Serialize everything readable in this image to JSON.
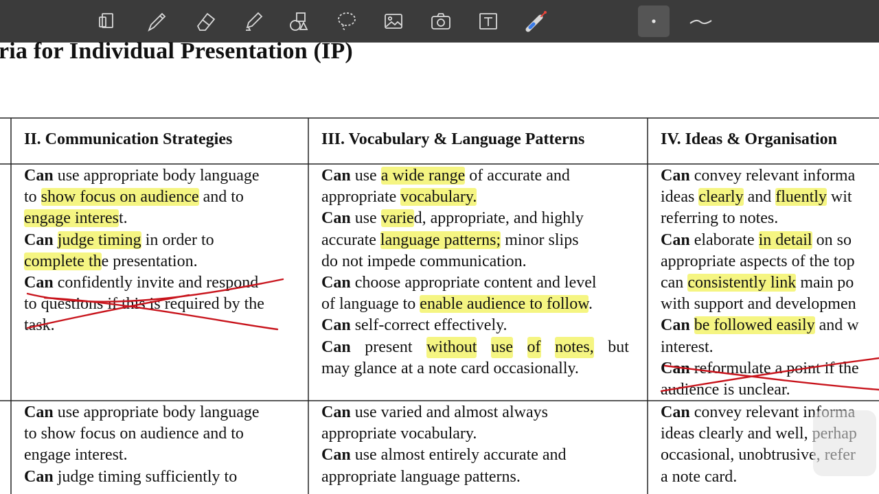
{
  "toolbar": {
    "tools": [
      {
        "name": "page-tool-icon"
      },
      {
        "name": "pen-tool-icon"
      },
      {
        "name": "eraser-tool-icon"
      },
      {
        "name": "highlighter-tool-icon"
      },
      {
        "name": "shapes-tool-icon"
      },
      {
        "name": "lasso-tool-icon"
      },
      {
        "name": "image-tool-icon"
      },
      {
        "name": "camera-tool-icon"
      },
      {
        "name": "text-tool-icon"
      },
      {
        "name": "laser-pointer-icon"
      },
      {
        "name": "stroke-dot-icon"
      },
      {
        "name": "stroke-curve-icon"
      }
    ],
    "colors": {
      "bar": "#3b3b3b",
      "icon": "#d9d9d9",
      "active_bg": "#555555",
      "laser_red": "#e8443a",
      "laser_blue": "#3a7be8"
    }
  },
  "document": {
    "title": "ria for Individual Presentation (IP)",
    "headers": {
      "col2": "II. Communication Strategies",
      "col3": "III. Vocabulary & Language Patterns",
      "col4": "IV. Ideas & Organisation"
    },
    "highlight_color": "#f5f582",
    "annotation_color": "#c8141c",
    "row1": {
      "col2": {
        "l1": [
          [
            "Can",
            "b"
          ],
          " use appropriate body language"
        ],
        "l2": [
          "to ",
          [
            "show focus on audience",
            "hl"
          ],
          " and to"
        ],
        "l3": [
          [
            "engage interes",
            "hl"
          ],
          "t."
        ],
        "l4": [
          [
            "Can",
            "b"
          ],
          " ",
          [
            "judge timing",
            "hl"
          ],
          " in order to"
        ],
        "l5": [
          [
            "complete th",
            "hl"
          ],
          "e presentation."
        ],
        "l6": [
          [
            "Can",
            "b"
          ],
          " confidently invite and respond"
        ],
        "l7": [
          "to questions if this is required by the"
        ],
        "l8": [
          "task."
        ]
      },
      "col3": {
        "l1": [
          [
            "Can",
            "b"
          ],
          " use ",
          [
            "a wide range",
            "hl"
          ],
          " of accurate and"
        ],
        "l2": [
          " appropriate ",
          [
            "vocabulary.",
            "hl"
          ]
        ],
        "l3": [
          [
            "Can",
            "b"
          ],
          " use ",
          [
            "varie",
            "hl"
          ],
          "d, appropriate, and highly"
        ],
        "l4": [
          "accurate ",
          [
            "language patterns;",
            "hl"
          ],
          " minor slips"
        ],
        "l5": [
          "do not impede communication."
        ],
        "l6": [
          [
            "Can",
            "b"
          ],
          " choose appropriate content and level"
        ],
        "l7": [
          "of language to ",
          [
            "enable audience to follow",
            "hl"
          ],
          "."
        ],
        "l8": [
          [
            "Can",
            "b"
          ],
          " self-correct effectively."
        ],
        "l9": [
          [
            "Can",
            "b"
          ],
          "present",
          [
            "without",
            "hl"
          ],
          [
            "use",
            "hl"
          ],
          [
            "of",
            "hl"
          ],
          [
            "notes,",
            "hl"
          ],
          "but"
        ],
        "l10": [
          "may glance at a note card occasionally."
        ]
      },
      "col4": {
        "l1": [
          [
            "Can",
            "b"
          ],
          " convey relevant informa"
        ],
        "l2": [
          "ideas ",
          [
            "clearly",
            "hl"
          ],
          " and ",
          [
            "fluently",
            "hl"
          ],
          " wit"
        ],
        "l3": [
          "referring to notes."
        ],
        "l4": [
          [
            "Can",
            "b"
          ],
          " elaborate ",
          [
            "in detail",
            "hl"
          ],
          " on so"
        ],
        "l5": [
          "appropriate aspects of the top"
        ],
        "l6": [
          "can ",
          [
            "consistently link",
            "hl"
          ],
          " main po"
        ],
        "l7": [
          "with support and developmen"
        ],
        "l8": [
          [
            "Can",
            "b"
          ],
          " ",
          [
            "be followed easily",
            "hl"
          ],
          " and w"
        ],
        "l9": [
          "interest."
        ],
        "l10": [
          [
            "Can",
            "b"
          ],
          " reformulate a point if the"
        ],
        "l11": [
          "audience is unclear."
        ]
      }
    },
    "row2": {
      "col2": {
        "l1": [
          [
            "Can",
            "b"
          ],
          " use appropriate body language"
        ],
        "l2": [
          "to show focus on audience and to"
        ],
        "l3": [
          "engage interest."
        ],
        "l4": [
          [
            "Can",
            "b"
          ],
          " judge timing sufficiently to"
        ]
      },
      "col3": {
        "l1": [
          [
            "Can",
            "b"
          ],
          " use varied and almost always"
        ],
        "l2": [
          "appropriate vocabulary."
        ],
        "l3": [
          [
            "Can",
            "b"
          ],
          " use almost entirely accurate and"
        ],
        "l4": [
          "appropriate language patterns."
        ]
      },
      "col4": {
        "l1": [
          [
            "Can",
            "b"
          ],
          " convey relevant informa"
        ],
        "l2": [
          "ideas clearly and well, perhap"
        ],
        "l3": [
          "occasional, unobtrusive, refer"
        ],
        "l4": [
          "a note card."
        ]
      }
    }
  }
}
